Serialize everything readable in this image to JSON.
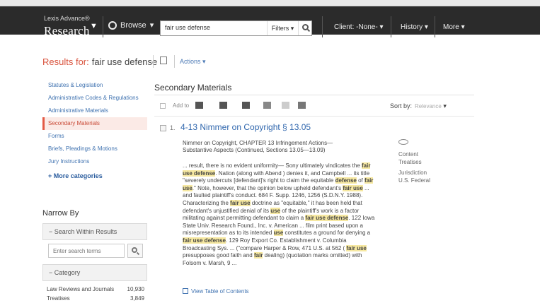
{
  "app": {
    "brand_top": "Lexis Advance®",
    "brand_main": "Research",
    "browse_label": "Browse",
    "search_value": "fair use defense",
    "filters_label": "Filters",
    "client_label": "Client: -None-",
    "history_label": "History",
    "more_label": "More"
  },
  "results": {
    "label": "Results for:",
    "query": "fair use defense",
    "actions_label": "Actions"
  },
  "sidebar": {
    "items": [
      {
        "label": "Statutes & Legislation"
      },
      {
        "label": "Administrative Codes & Regulations"
      },
      {
        "label": "Administrative Materials"
      },
      {
        "label": "Secondary Materials"
      },
      {
        "label": "Forms"
      },
      {
        "label": "Briefs, Pleadings & Motions"
      },
      {
        "label": "Jury Instructions"
      }
    ],
    "more_categories": "More categories",
    "narrow_by": "Narrow By",
    "search_within": "Search Within Results",
    "search_within_placeholder": "Enter search terms",
    "category_label": "Category",
    "categories": [
      {
        "name": "Law Reviews and Journals",
        "count": "10,930"
      },
      {
        "name": "Treatises",
        "count": "3,849"
      }
    ]
  },
  "main": {
    "section_title": "Secondary Materials",
    "toolbar": {
      "add_to": "Add to",
      "sort_by": "Sort by:",
      "sort_value": "Relevance"
    },
    "result": {
      "number": "1.",
      "title": "4-13 Nimmer on Copyright § 13.05",
      "meta_line1": "Nimmer on Copyright, CHAPTER 13 Infringement Actions—",
      "meta_line2": "Substantive Aspects (Continued, Sections 13.05—13.09)",
      "content_type_label": "Content",
      "content_type": "Treatises",
      "jurisdiction_label": "Jurisdiction",
      "jurisdiction": "U.S. Federal",
      "toc_label": "View Table of Contents"
    }
  }
}
